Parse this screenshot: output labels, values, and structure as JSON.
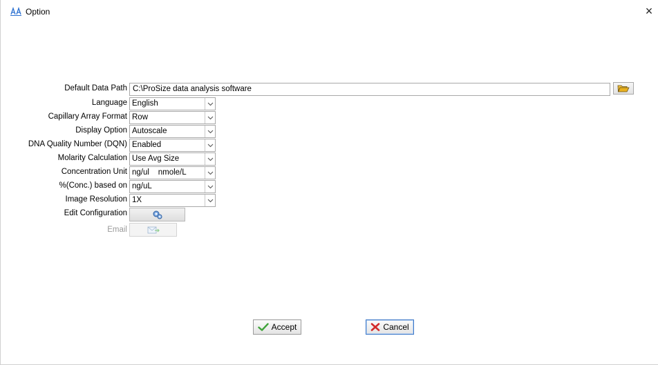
{
  "window": {
    "title": "Option",
    "close_symbol": "×"
  },
  "form": {
    "default_data_path": {
      "label": "Default Data Path",
      "value": "C:\\ProSize data analysis software"
    },
    "language": {
      "label": "Language",
      "value": "English"
    },
    "capillary_array_format": {
      "label": "Capillary Array Format",
      "value": "Row"
    },
    "display_option": {
      "label": "Display Option",
      "value": "Autoscale"
    },
    "dqn": {
      "label": "DNA Quality Number (DQN)",
      "value": "Enabled"
    },
    "molarity_calculation": {
      "label": "Molarity Calculation",
      "value": "Use Avg Size"
    },
    "concentration_unit": {
      "label": "Concentration Unit",
      "value": "ng/ul    nmole/L"
    },
    "percent_conc": {
      "label": "%(Conc.) based on",
      "value": "ng/uL"
    },
    "image_resolution": {
      "label": "Image Resolution",
      "value": "1X"
    },
    "edit_configuration": {
      "label": "Edit Configuration"
    },
    "email": {
      "label": "Email"
    }
  },
  "buttons": {
    "accept": "Accept",
    "cancel": "Cancel"
  },
  "icons": {
    "app": "app-logo-icon",
    "browse": "folder-open-icon",
    "dropdown": "chevron-down-icon",
    "configure": "gears-icon",
    "email": "email-send-icon",
    "accept": "checkmark-icon",
    "cancel": "x-cross-icon"
  },
  "colors": {
    "accept_check": "#3fa33a",
    "cancel_x": "#d32a2a",
    "focus_border": "#3c78c8"
  }
}
